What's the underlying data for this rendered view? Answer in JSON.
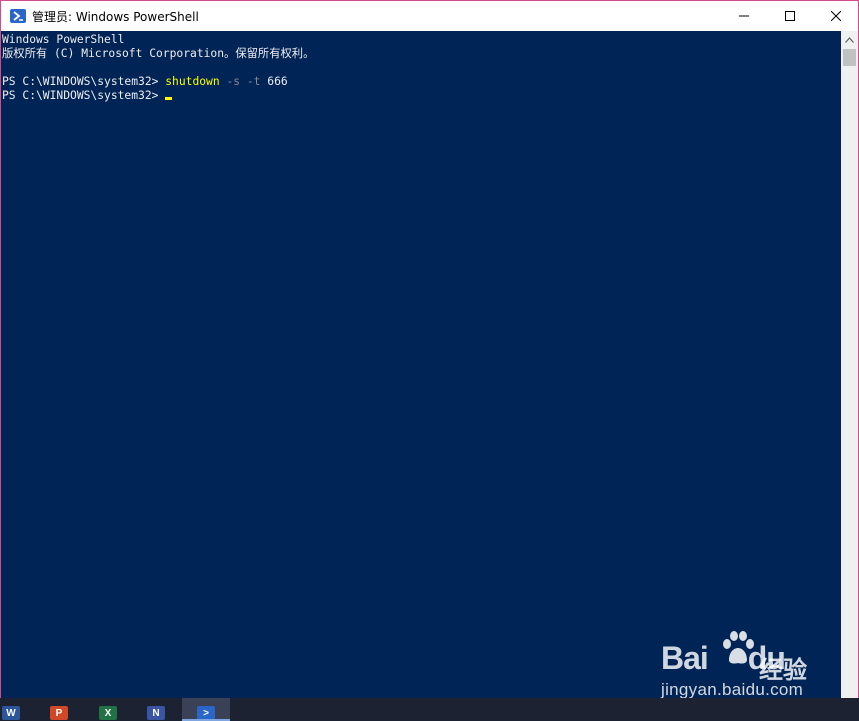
{
  "window": {
    "title": "管理员: Windows PowerShell",
    "controls": {
      "minimize_icon": "minimize-icon",
      "maximize_icon": "maximize-icon",
      "close_icon": "close-icon"
    }
  },
  "console": {
    "header_line1": "Windows PowerShell",
    "header_line2": "版权所有 (C) Microsoft Corporation。保留所有权利。",
    "prompt1": "PS C:\\WINDOWS\\system32> ",
    "command": "shutdown",
    "param1": " -s",
    "param2": " -t",
    "arg": " 666",
    "prompt2": "PS C:\\WINDOWS\\system32>"
  },
  "taskbar": {
    "apps": [
      {
        "name": "word",
        "glyph": "W",
        "color": "#2b579a"
      },
      {
        "name": "powerpoint",
        "glyph": "P",
        "color": "#d24726"
      },
      {
        "name": "excel",
        "glyph": "X",
        "color": "#217346"
      },
      {
        "name": "visio",
        "glyph": "N",
        "color": "#3955a3"
      },
      {
        "name": "powershell",
        "glyph": ">",
        "color": "#2a66c7"
      }
    ]
  },
  "watermark": {
    "logo": "Bai",
    "logo2": "du",
    "cn": "经验",
    "url": "jingyan.baidu.com"
  },
  "colors": {
    "console_bg": "#012456",
    "console_fg": "#eeedf0",
    "command": "#fdfd00",
    "parameter": "#8a8a8a"
  }
}
